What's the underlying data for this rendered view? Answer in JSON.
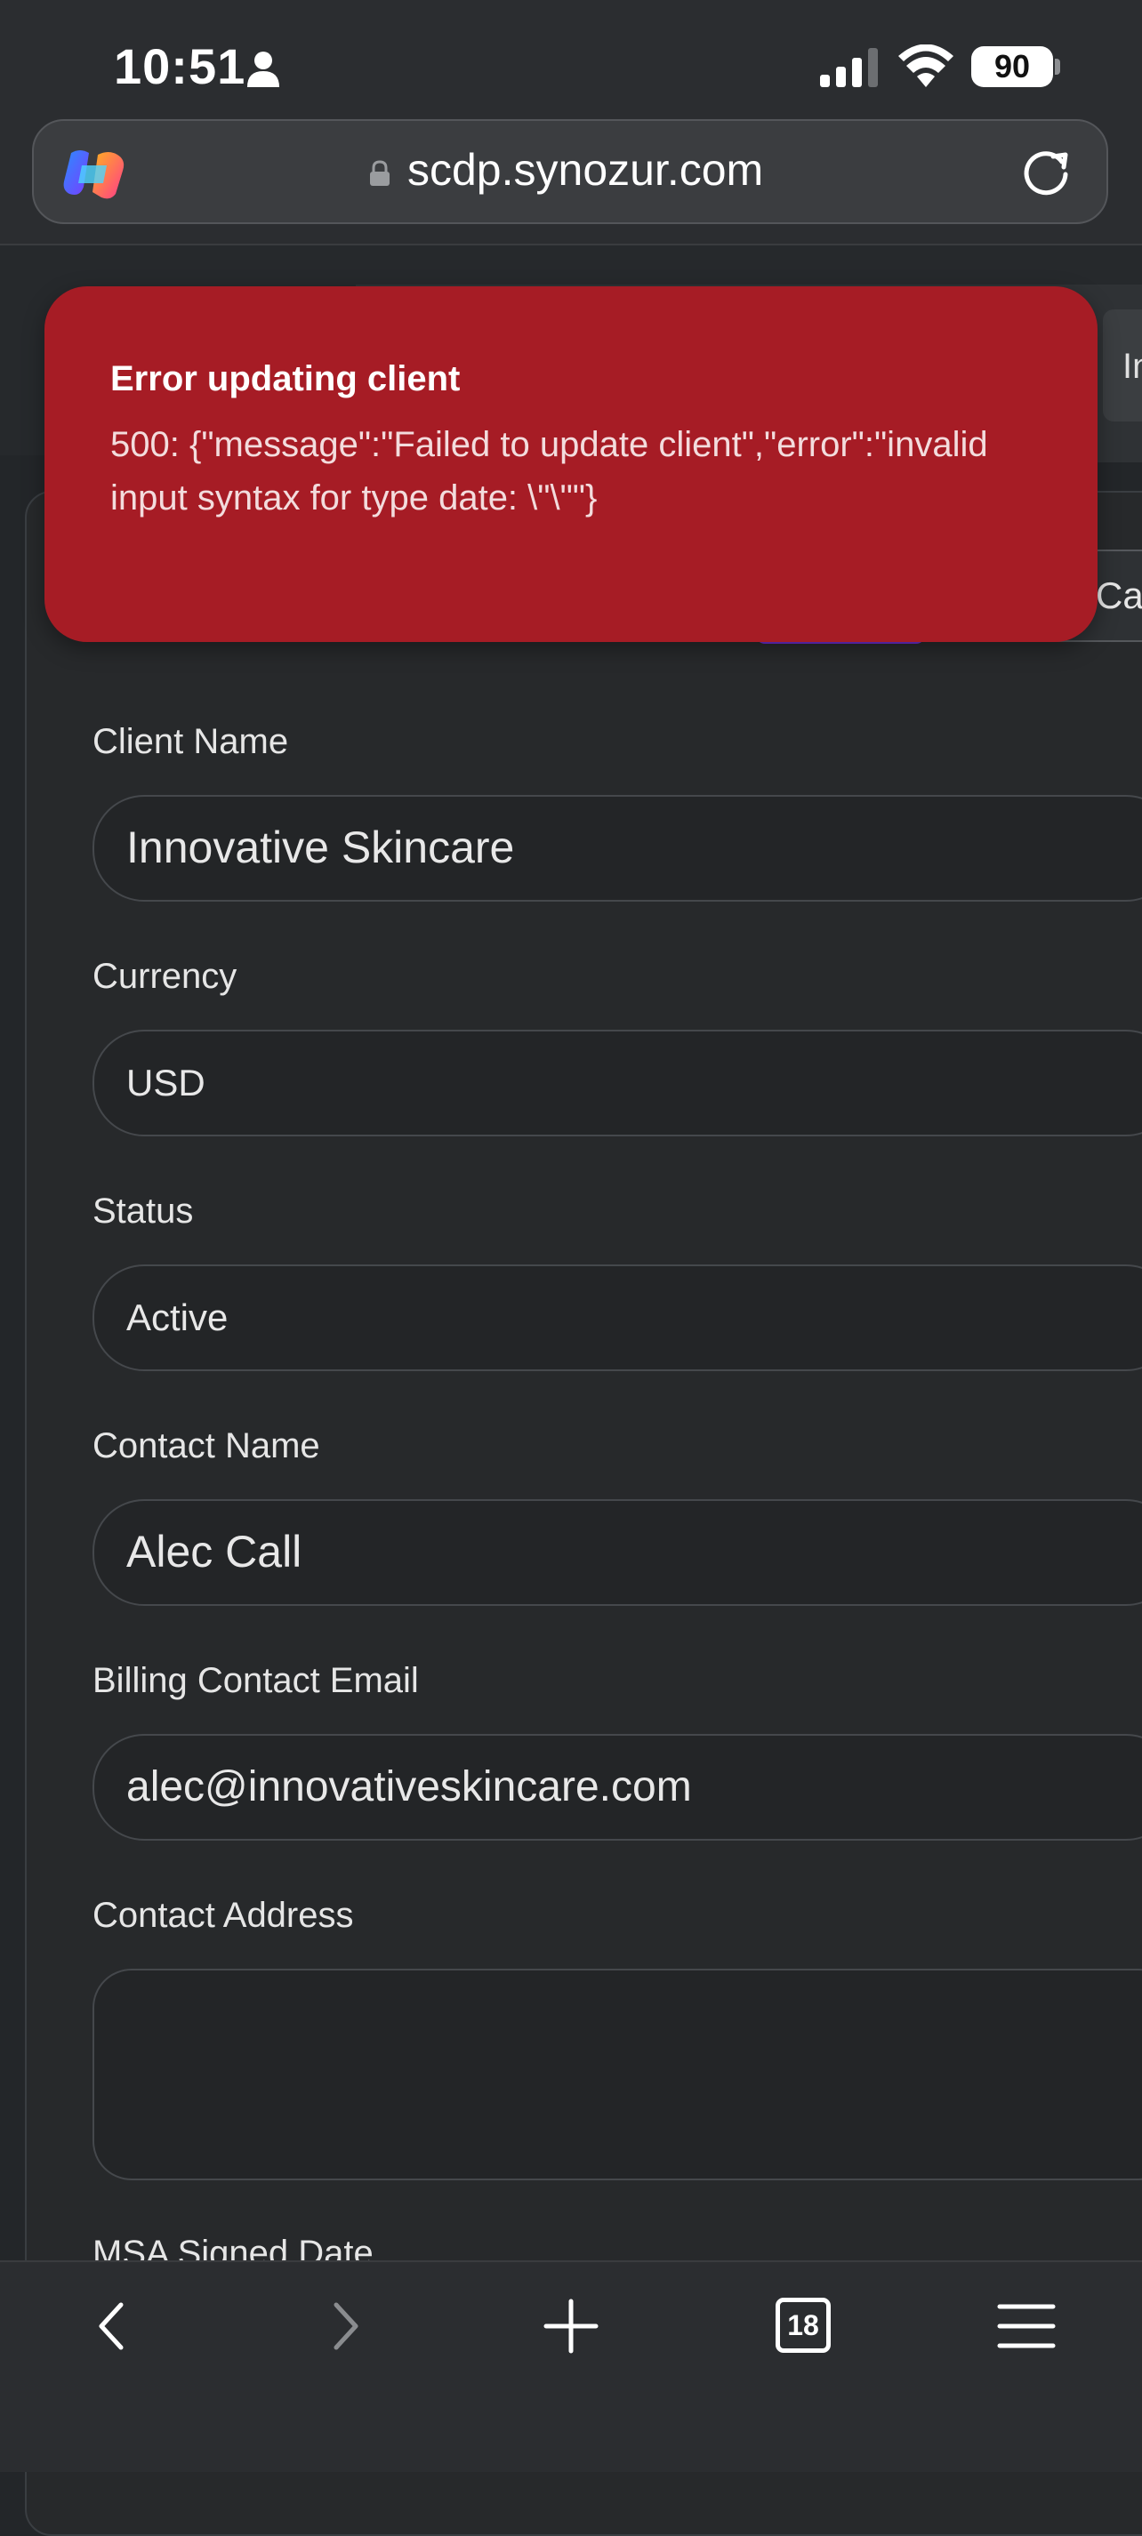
{
  "status_bar": {
    "time": "10:51",
    "battery": "90"
  },
  "browser": {
    "url": "scdp.synozur.com",
    "tabs_count": "18"
  },
  "page": {
    "tab_fragment": "In",
    "cancel_fragment": "Ca"
  },
  "toast": {
    "title": "Error updating client",
    "message": "500: {\"message\":\"Failed to update client\",\"error\":\"invalid input syntax for type date: \\\"\\\"\"}"
  },
  "form": {
    "client_name": {
      "label": "Client Name",
      "value": "Innovative Skincare"
    },
    "currency": {
      "label": "Currency",
      "value": "USD"
    },
    "status": {
      "label": "Status",
      "value": "Active"
    },
    "contact_name": {
      "label": "Contact Name",
      "value": "Alec Call"
    },
    "billing_email": {
      "label": "Billing Contact Email",
      "value": "alec@innovativeskincare.com"
    },
    "contact_address": {
      "label": "Contact Address",
      "value": ""
    },
    "msa_signed_date": {
      "label": "MSA Signed Date"
    }
  },
  "colors": {
    "toast_bg": "#a61c25",
    "background": "#232629",
    "accent": "#6b2fd0"
  }
}
